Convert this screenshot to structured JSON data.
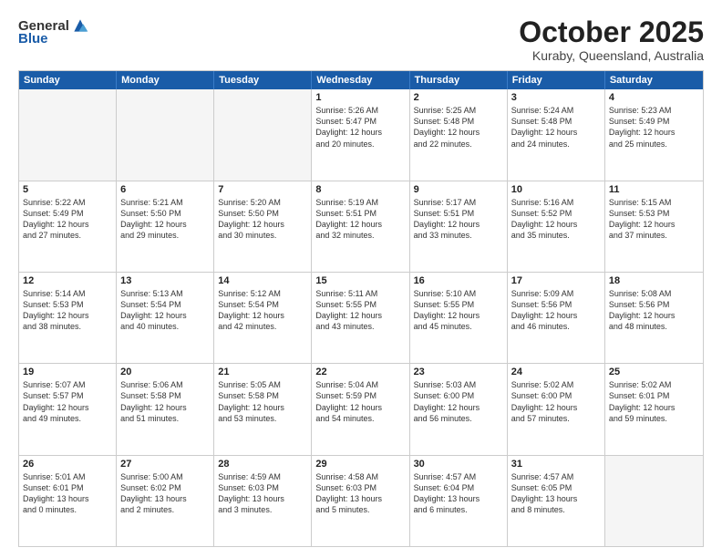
{
  "header": {
    "logo_general": "General",
    "logo_blue": "Blue",
    "month": "October 2025",
    "location": "Kuraby, Queensland, Australia"
  },
  "weekdays": [
    "Sunday",
    "Monday",
    "Tuesday",
    "Wednesday",
    "Thursday",
    "Friday",
    "Saturday"
  ],
  "rows": [
    [
      {
        "day": "",
        "text": ""
      },
      {
        "day": "",
        "text": ""
      },
      {
        "day": "",
        "text": ""
      },
      {
        "day": "1",
        "text": "Sunrise: 5:26 AM\nSunset: 5:47 PM\nDaylight: 12 hours\nand 20 minutes."
      },
      {
        "day": "2",
        "text": "Sunrise: 5:25 AM\nSunset: 5:48 PM\nDaylight: 12 hours\nand 22 minutes."
      },
      {
        "day": "3",
        "text": "Sunrise: 5:24 AM\nSunset: 5:48 PM\nDaylight: 12 hours\nand 24 minutes."
      },
      {
        "day": "4",
        "text": "Sunrise: 5:23 AM\nSunset: 5:49 PM\nDaylight: 12 hours\nand 25 minutes."
      }
    ],
    [
      {
        "day": "5",
        "text": "Sunrise: 5:22 AM\nSunset: 5:49 PM\nDaylight: 12 hours\nand 27 minutes."
      },
      {
        "day": "6",
        "text": "Sunrise: 5:21 AM\nSunset: 5:50 PM\nDaylight: 12 hours\nand 29 minutes."
      },
      {
        "day": "7",
        "text": "Sunrise: 5:20 AM\nSunset: 5:50 PM\nDaylight: 12 hours\nand 30 minutes."
      },
      {
        "day": "8",
        "text": "Sunrise: 5:19 AM\nSunset: 5:51 PM\nDaylight: 12 hours\nand 32 minutes."
      },
      {
        "day": "9",
        "text": "Sunrise: 5:17 AM\nSunset: 5:51 PM\nDaylight: 12 hours\nand 33 minutes."
      },
      {
        "day": "10",
        "text": "Sunrise: 5:16 AM\nSunset: 5:52 PM\nDaylight: 12 hours\nand 35 minutes."
      },
      {
        "day": "11",
        "text": "Sunrise: 5:15 AM\nSunset: 5:53 PM\nDaylight: 12 hours\nand 37 minutes."
      }
    ],
    [
      {
        "day": "12",
        "text": "Sunrise: 5:14 AM\nSunset: 5:53 PM\nDaylight: 12 hours\nand 38 minutes."
      },
      {
        "day": "13",
        "text": "Sunrise: 5:13 AM\nSunset: 5:54 PM\nDaylight: 12 hours\nand 40 minutes."
      },
      {
        "day": "14",
        "text": "Sunrise: 5:12 AM\nSunset: 5:54 PM\nDaylight: 12 hours\nand 42 minutes."
      },
      {
        "day": "15",
        "text": "Sunrise: 5:11 AM\nSunset: 5:55 PM\nDaylight: 12 hours\nand 43 minutes."
      },
      {
        "day": "16",
        "text": "Sunrise: 5:10 AM\nSunset: 5:55 PM\nDaylight: 12 hours\nand 45 minutes."
      },
      {
        "day": "17",
        "text": "Sunrise: 5:09 AM\nSunset: 5:56 PM\nDaylight: 12 hours\nand 46 minutes."
      },
      {
        "day": "18",
        "text": "Sunrise: 5:08 AM\nSunset: 5:56 PM\nDaylight: 12 hours\nand 48 minutes."
      }
    ],
    [
      {
        "day": "19",
        "text": "Sunrise: 5:07 AM\nSunset: 5:57 PM\nDaylight: 12 hours\nand 49 minutes."
      },
      {
        "day": "20",
        "text": "Sunrise: 5:06 AM\nSunset: 5:58 PM\nDaylight: 12 hours\nand 51 minutes."
      },
      {
        "day": "21",
        "text": "Sunrise: 5:05 AM\nSunset: 5:58 PM\nDaylight: 12 hours\nand 53 minutes."
      },
      {
        "day": "22",
        "text": "Sunrise: 5:04 AM\nSunset: 5:59 PM\nDaylight: 12 hours\nand 54 minutes."
      },
      {
        "day": "23",
        "text": "Sunrise: 5:03 AM\nSunset: 6:00 PM\nDaylight: 12 hours\nand 56 minutes."
      },
      {
        "day": "24",
        "text": "Sunrise: 5:02 AM\nSunset: 6:00 PM\nDaylight: 12 hours\nand 57 minutes."
      },
      {
        "day": "25",
        "text": "Sunrise: 5:02 AM\nSunset: 6:01 PM\nDaylight: 12 hours\nand 59 minutes."
      }
    ],
    [
      {
        "day": "26",
        "text": "Sunrise: 5:01 AM\nSunset: 6:01 PM\nDaylight: 13 hours\nand 0 minutes."
      },
      {
        "day": "27",
        "text": "Sunrise: 5:00 AM\nSunset: 6:02 PM\nDaylight: 13 hours\nand 2 minutes."
      },
      {
        "day": "28",
        "text": "Sunrise: 4:59 AM\nSunset: 6:03 PM\nDaylight: 13 hours\nand 3 minutes."
      },
      {
        "day": "29",
        "text": "Sunrise: 4:58 AM\nSunset: 6:03 PM\nDaylight: 13 hours\nand 5 minutes."
      },
      {
        "day": "30",
        "text": "Sunrise: 4:57 AM\nSunset: 6:04 PM\nDaylight: 13 hours\nand 6 minutes."
      },
      {
        "day": "31",
        "text": "Sunrise: 4:57 AM\nSunset: 6:05 PM\nDaylight: 13 hours\nand 8 minutes."
      },
      {
        "day": "",
        "text": ""
      }
    ]
  ]
}
